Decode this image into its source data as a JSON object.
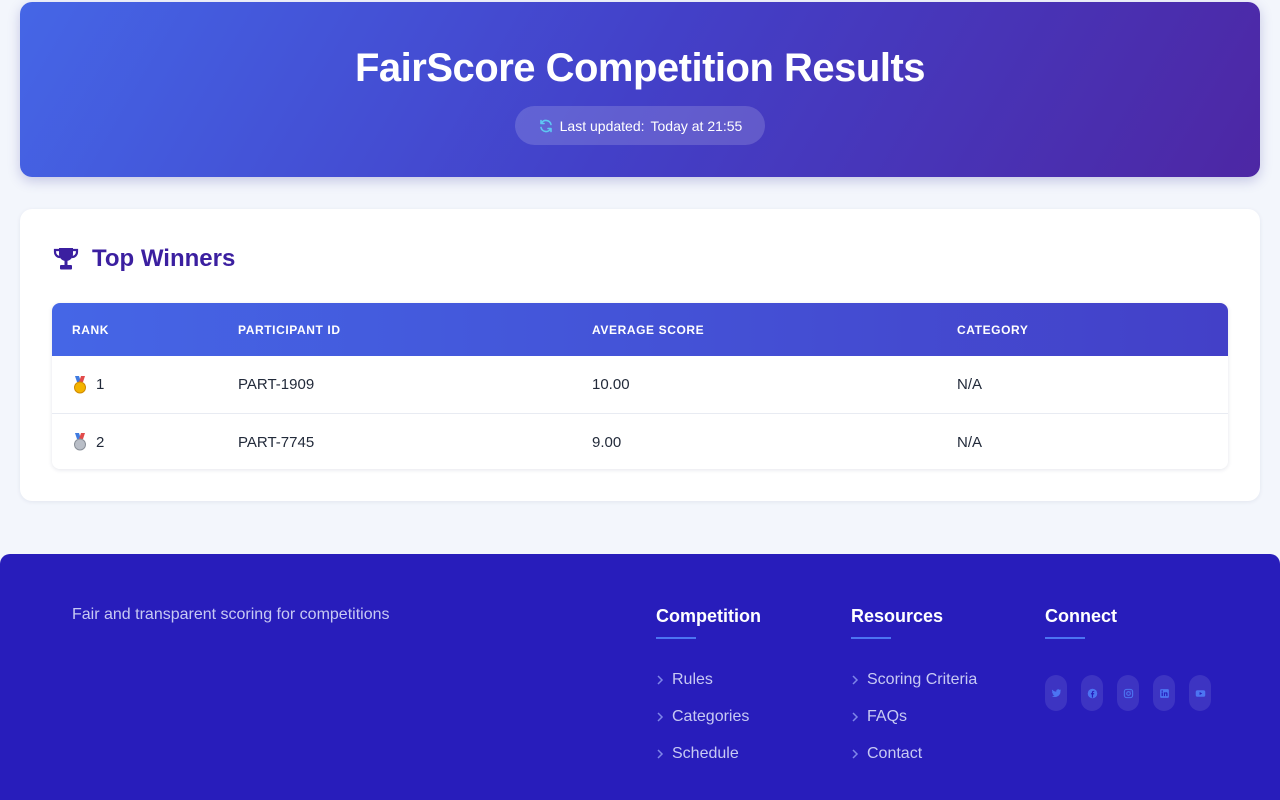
{
  "header": {
    "title": "FairScore Competition Results",
    "updated_label": "Last updated:",
    "updated_value": "Today at 21:55"
  },
  "winners": {
    "heading": "Top Winners",
    "columns": [
      "RANK",
      "PARTICIPANT ID",
      "AVERAGE SCORE",
      "CATEGORY"
    ],
    "rows": [
      {
        "medal": "gold-medal-icon",
        "rank": "1",
        "participant_id": "PART-1909",
        "average_score": "10.00",
        "category": "N/A"
      },
      {
        "medal": "silver-medal-icon",
        "rank": "2",
        "participant_id": "PART-7745",
        "average_score": "9.00",
        "category": "N/A"
      }
    ]
  },
  "footer": {
    "tagline": "Fair and transparent scoring for competitions",
    "competition": {
      "heading": "Competition",
      "links": [
        "Rules",
        "Categories",
        "Schedule"
      ]
    },
    "resources": {
      "heading": "Resources",
      "links": [
        "Scoring Criteria",
        "FAQs",
        "Contact"
      ]
    },
    "connect": {
      "heading": "Connect",
      "icons": [
        "twitter-icon",
        "facebook-icon",
        "instagram-icon",
        "linkedin-icon",
        "youtube-icon"
      ]
    }
  },
  "colors": {
    "header_gradient_start": "#4566e6",
    "header_gradient_end": "#4d27a4",
    "accent_purple": "#3b1fa0",
    "footer_bg": "#281dbb",
    "footer_underline": "#4c74f2",
    "refresh_icon": "#5ec8f2"
  }
}
